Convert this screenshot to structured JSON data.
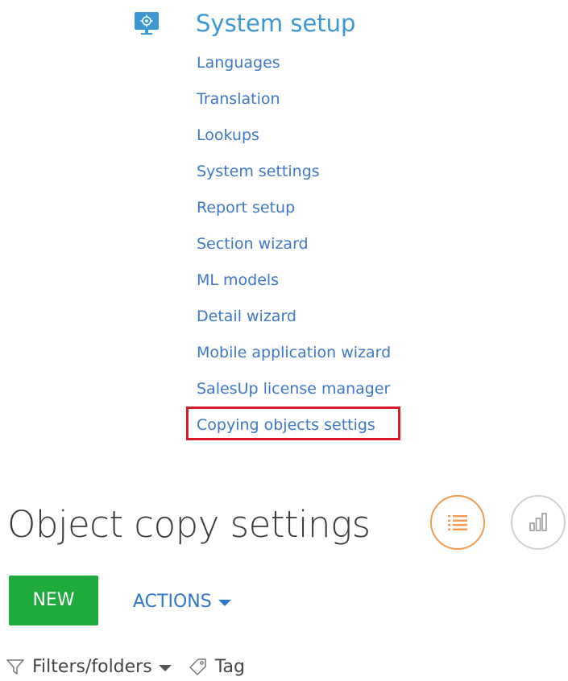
{
  "system_setup": {
    "title": "System setup",
    "icon": "system-setup-icon",
    "links": [
      "Languages",
      "Translation",
      "Lookups",
      "System settings",
      "Report setup",
      "Section wizard",
      "ML models",
      "Detail wizard",
      "Mobile application wizard",
      "SalesUp license manager",
      "Copying objects settigs"
    ],
    "highlighted_link": "Copying objects settigs"
  },
  "section": {
    "title": "Object copy settings",
    "view_buttons": [
      "list-view-icon",
      "analytics-view-icon"
    ]
  },
  "toolbar": {
    "new_label": "NEW",
    "actions_label": "ACTIONS"
  },
  "filters": {
    "filters_label": "Filters/folders",
    "tag_label": "Tag"
  },
  "colors": {
    "link": "#3d78c7",
    "menu_title": "#3c97d3",
    "new_button": "#1faa3e",
    "highlight": "#d71b27",
    "list_view_accent": "#f19a50"
  }
}
